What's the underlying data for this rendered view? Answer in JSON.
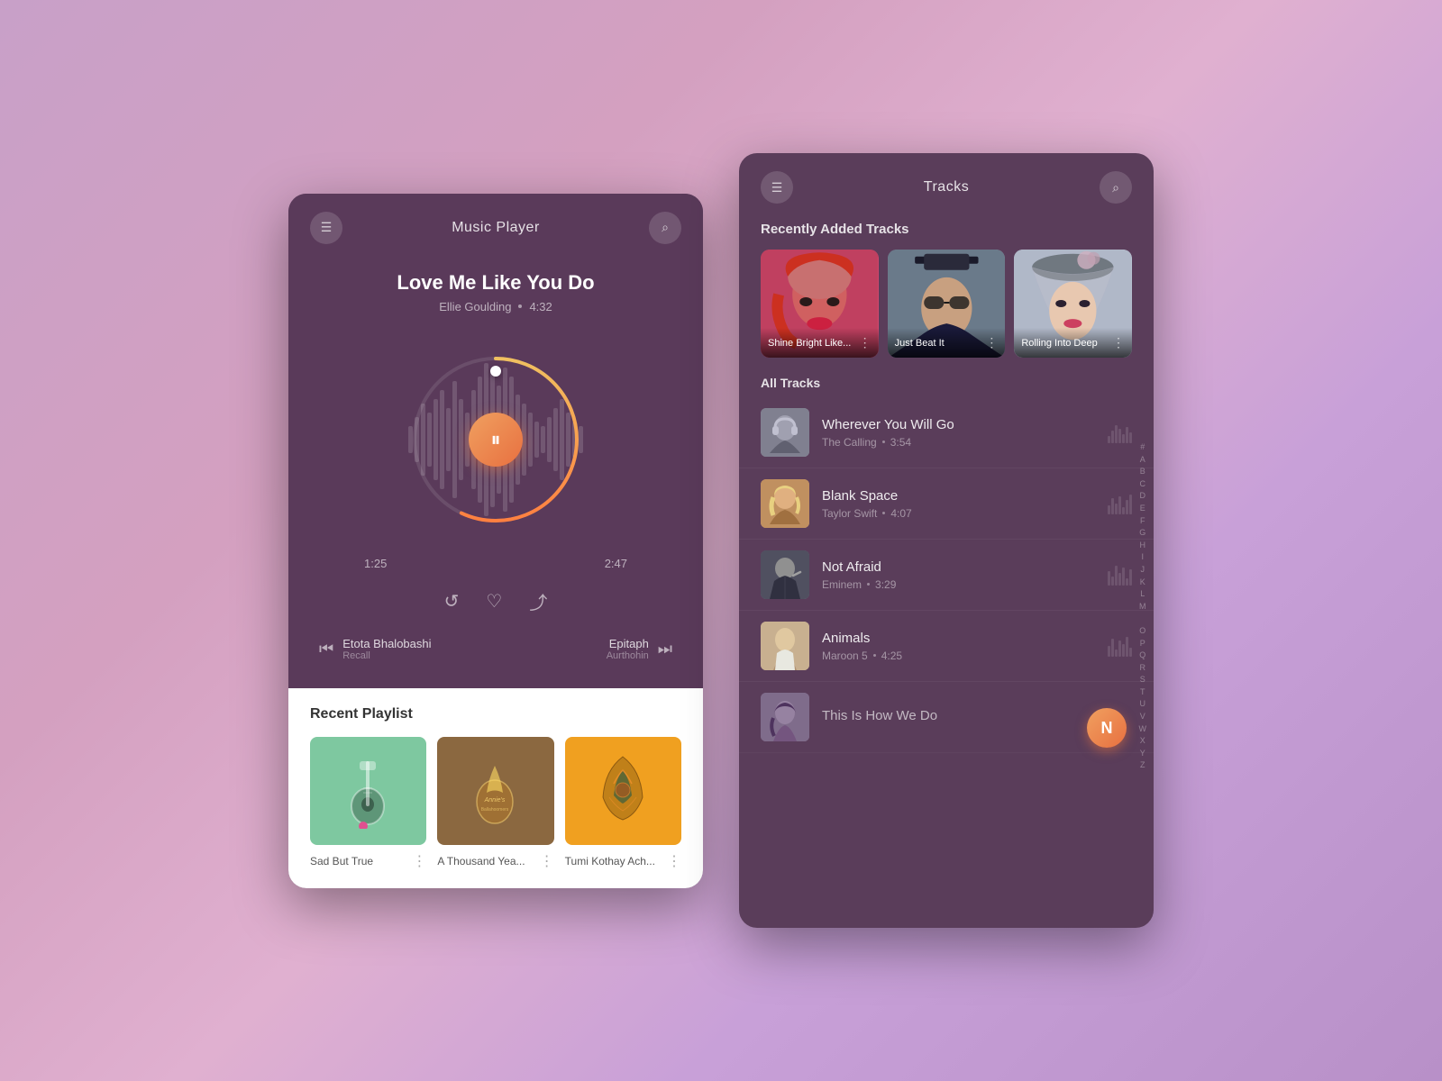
{
  "player": {
    "title": "Music Player",
    "menu_icon": "☰",
    "search_icon": "⌕",
    "current_track": {
      "name": "Love Me Like You Do",
      "artist": "Ellie Goulding",
      "duration": "4:32",
      "current_time": "1:25",
      "end_time": "2:47"
    },
    "controls": {
      "repeat": "↺",
      "heart": "♡",
      "share": "⤴"
    },
    "prev_track": {
      "name": "Etota Bhalobashi",
      "album": "Recall",
      "icon": "⏮"
    },
    "next_track": {
      "name": "Epitaph",
      "album": "Aurthohin",
      "icon": "⏭"
    },
    "pause_icon": "⏸"
  },
  "playlist": {
    "title": "Recent Playlist",
    "items": [
      {
        "name": "Sad But True",
        "dots": "⋮",
        "color": "#7ec8a0"
      },
      {
        "name": "A Thousand Yea...",
        "dots": "⋮",
        "color": "#8b6840"
      },
      {
        "name": "Tumi Kothay Ach...",
        "dots": "⋮",
        "color": "#f0a020"
      }
    ]
  },
  "tracks": {
    "title": "Tracks",
    "menu_icon": "☰",
    "search_icon": "⌕",
    "recently_added_label": "Recently Added Tracks",
    "all_tracks_label": "All Tracks",
    "recent_items": [
      {
        "name": "Shine Bright Like...",
        "dots": "⋮"
      },
      {
        "name": "Just Beat It",
        "dots": "⋮"
      },
      {
        "name": "Rolling Into Deep",
        "dots": "⋮"
      }
    ],
    "track_list": [
      {
        "name": "Wherever You Will Go",
        "artist": "The Calling",
        "duration": "3:54"
      },
      {
        "name": "Blank Space",
        "artist": "Taylor Swift",
        "duration": "4:07"
      },
      {
        "name": "Not Afraid",
        "artist": "Eminem",
        "duration": "3:29"
      },
      {
        "name": "Animals",
        "artist": "Maroon 5",
        "duration": "4:25"
      },
      {
        "name": "This Is How We Do",
        "artist": "",
        "duration": ""
      }
    ],
    "alphabet": [
      "#",
      "A",
      "B",
      "C",
      "D",
      "E",
      "F",
      "G",
      "H",
      "I",
      "J",
      "K",
      "L",
      "M",
      "N",
      "O",
      "P",
      "Q",
      "R",
      "S",
      "T",
      "U",
      "V",
      "W",
      "X",
      "Y",
      "Z"
    ],
    "active_letter": "N"
  }
}
